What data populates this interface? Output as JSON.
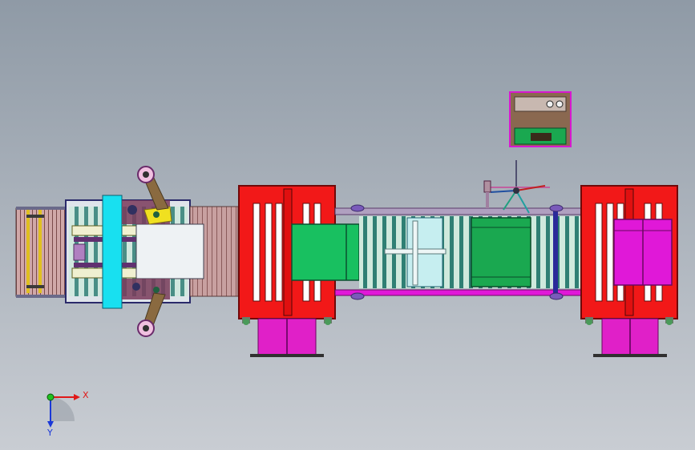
{
  "viewport": {
    "background_top": "#8f9aa6",
    "background_bottom": "#c9cdd3"
  },
  "triad": {
    "x_label": "X",
    "y_label": "Y",
    "x_color": "#e01818",
    "y_color": "#1a38d8",
    "origin_color": "#20c020"
  },
  "colors": {
    "frame_red": "#f21818",
    "cover_green": "#18c060",
    "pallet_green": "#1aa850",
    "magenta": "#e018d8",
    "pink_leg": "#e020c8",
    "cyan_plate": "#18e0f0",
    "roller_light": "#c8e6d8",
    "roller_dark": "#3a9a8a",
    "conveyor_belt": "#c89898",
    "purple_rail": "#c020c0",
    "brown_arm": "#8a6a40",
    "yellow_part": "#f0e020",
    "panel_box": "#8a6850",
    "panel_border": "#d818d0",
    "panel_green": "#1aa850"
  }
}
